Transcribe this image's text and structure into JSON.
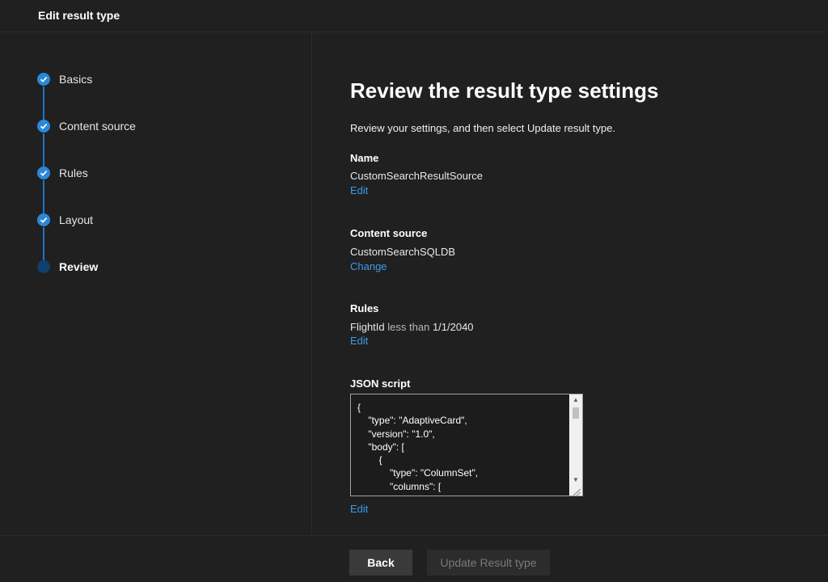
{
  "header": {
    "title": "Edit result type"
  },
  "steps": [
    {
      "label": "Basics",
      "status": "complete"
    },
    {
      "label": "Content source",
      "status": "complete"
    },
    {
      "label": "Rules",
      "status": "complete"
    },
    {
      "label": "Layout",
      "status": "complete"
    },
    {
      "label": "Review",
      "status": "current"
    }
  ],
  "main": {
    "title": "Review the result type settings",
    "intro": "Review your settings, and then select Update result type.",
    "name": {
      "heading": "Name",
      "value": "CustomSearchResultSource",
      "link": "Edit"
    },
    "content_source": {
      "heading": "Content source",
      "value": "CustomSearchSQLDB",
      "link": "Change"
    },
    "rules": {
      "heading": "Rules",
      "field": "FlightId",
      "operator": "less than",
      "value": "1/1/2040",
      "link": "Edit"
    },
    "json": {
      "heading": "JSON script",
      "content": "{\n    \"type\": \"AdaptiveCard\",\n    \"version\": \"1.0\",\n    \"body\": [\n        {\n            \"type\": \"ColumnSet\",\n            \"columns\": [\n                {",
      "link": "Edit"
    }
  },
  "footer": {
    "back_label": "Back",
    "update_label": "Update Result type"
  },
  "colors": {
    "accent": "#2b88d8",
    "link": "#3d9be9",
    "background": "#202020"
  }
}
